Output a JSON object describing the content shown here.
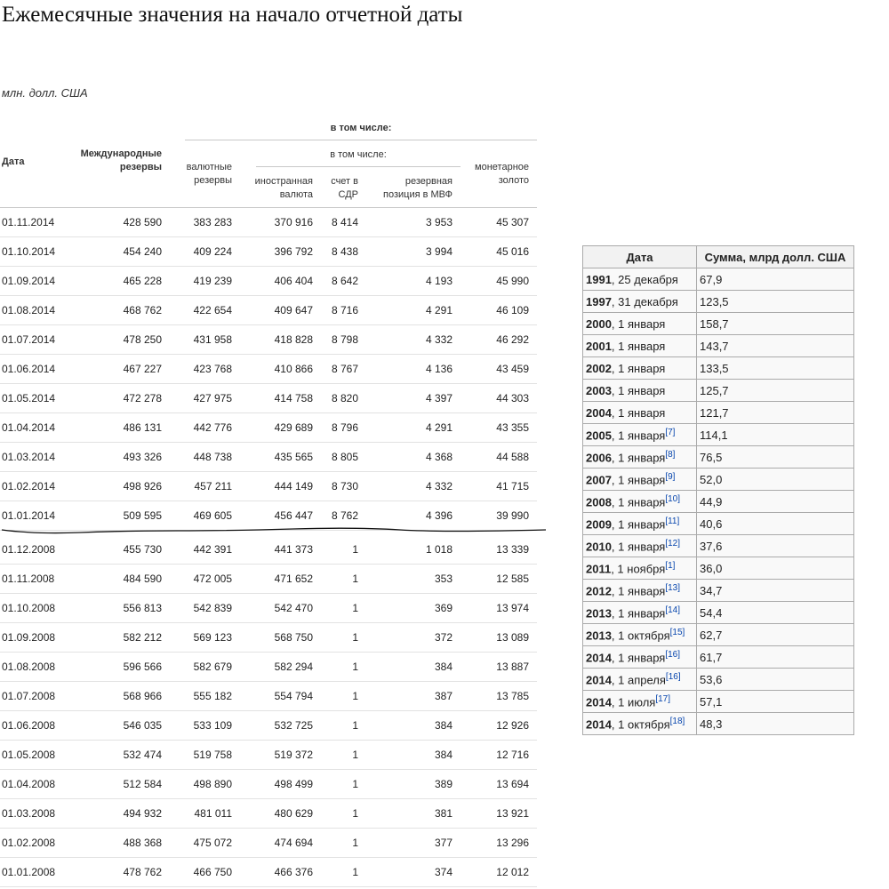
{
  "title": "Ежемесячные значения на начало отчетной даты",
  "units": "млн. долл. США",
  "header": {
    "date": "Дата",
    "intl_reserves": [
      "Международные",
      "резервы"
    ],
    "incl_top": "в том числе:",
    "fx_reserves": [
      "валютные",
      "резервы"
    ],
    "incl_sub": "в том числе:",
    "foreign_currency": [
      "иностранная",
      "валюта"
    ],
    "sdr": [
      "счет в",
      "СДР"
    ],
    "imf_position": [
      "резервная",
      "позиция в МВФ"
    ],
    "gold": [
      "монетарное",
      "золото"
    ]
  },
  "rows_2014": [
    [
      "01.11.2014",
      "428 590",
      "383 283",
      "370 916",
      "8 414",
      "3 953",
      "45 307"
    ],
    [
      "01.10.2014",
      "454 240",
      "409 224",
      "396 792",
      "8 438",
      "3 994",
      "45 016"
    ],
    [
      "01.09.2014",
      "465 228",
      "419 239",
      "406 404",
      "8 642",
      "4 193",
      "45 990"
    ],
    [
      "01.08.2014",
      "468 762",
      "422 654",
      "409 647",
      "8 716",
      "4 291",
      "46 109"
    ],
    [
      "01.07.2014",
      "478 250",
      "431 958",
      "418 828",
      "8 798",
      "4 332",
      "46 292"
    ],
    [
      "01.06.2014",
      "467 227",
      "423 768",
      "410 866",
      "8 767",
      "4 136",
      "43 459"
    ],
    [
      "01.05.2014",
      "472 278",
      "427 975",
      "414 758",
      "8 820",
      "4 397",
      "44 303"
    ],
    [
      "01.04.2014",
      "486 131",
      "442 776",
      "429 689",
      "8 796",
      "4 291",
      "43 355"
    ],
    [
      "01.03.2014",
      "493 326",
      "448 738",
      "435 565",
      "8 805",
      "4 368",
      "44 588"
    ],
    [
      "01.02.2014",
      "498 926",
      "457 211",
      "444 149",
      "8 730",
      "4 332",
      "41 715"
    ],
    [
      "01.01.2014",
      "509 595",
      "469 605",
      "456 447",
      "8 762",
      "4 396",
      "39 990"
    ]
  ],
  "rows_2008": [
    [
      "01.12.2008",
      "455 730",
      "442 391",
      "441 373",
      "1",
      "1 018",
      "13 339"
    ],
    [
      "01.11.2008",
      "484 590",
      "472 005",
      "471 652",
      "1",
      "353",
      "12 585"
    ],
    [
      "01.10.2008",
      "556 813",
      "542 839",
      "542 470",
      "1",
      "369",
      "13 974"
    ],
    [
      "01.09.2008",
      "582 212",
      "569 123",
      "568 750",
      "1",
      "372",
      "13 089"
    ],
    [
      "01.08.2008",
      "596 566",
      "582 679",
      "582 294",
      "1",
      "384",
      "13 887"
    ],
    [
      "01.07.2008",
      "568 966",
      "555 182",
      "554 794",
      "1",
      "387",
      "13 785"
    ],
    [
      "01.06.2008",
      "546 035",
      "533 109",
      "532 725",
      "1",
      "384",
      "12 926"
    ],
    [
      "01.05.2008",
      "532 474",
      "519 758",
      "519 372",
      "1",
      "384",
      "12 716"
    ],
    [
      "01.04.2008",
      "512 584",
      "498 890",
      "498 499",
      "1",
      "389",
      "13 694"
    ],
    [
      "01.03.2008",
      "494 932",
      "481 011",
      "480 629",
      "1",
      "381",
      "13 921"
    ],
    [
      "01.02.2008",
      "488 368",
      "475 072",
      "474 694",
      "1",
      "377",
      "13 296"
    ],
    [
      "01.01.2008",
      "478 762",
      "466 750",
      "466 376",
      "1",
      "374",
      "12 012"
    ]
  ],
  "side_table": {
    "col_date": "Дата",
    "col_sum": "Сумма, млрд долл. США",
    "rows": [
      {
        "year": "1991",
        "rest": ", 25 декабря",
        "ref": "",
        "value": "67,9"
      },
      {
        "year": "1997",
        "rest": ", 31 декабря",
        "ref": "",
        "value": "123,5"
      },
      {
        "year": "2000",
        "rest": ", 1 января",
        "ref": "",
        "value": "158,7"
      },
      {
        "year": "2001",
        "rest": ", 1 января",
        "ref": "",
        "value": "143,7"
      },
      {
        "year": "2002",
        "rest": ", 1 января",
        "ref": "",
        "value": "133,5"
      },
      {
        "year": "2003",
        "rest": ", 1 января",
        "ref": "",
        "value": "125,7"
      },
      {
        "year": "2004",
        "rest": ", 1 января",
        "ref": "",
        "value": "121,7"
      },
      {
        "year": "2005",
        "rest": ", 1 января",
        "ref": "[7]",
        "value": "114,1"
      },
      {
        "year": "2006",
        "rest": ", 1 января",
        "ref": "[8]",
        "value": "76,5"
      },
      {
        "year": "2007",
        "rest": ", 1 января",
        "ref": "[9]",
        "value": "52,0"
      },
      {
        "year": "2008",
        "rest": ", 1 января",
        "ref": "[10]",
        "value": "44,9"
      },
      {
        "year": "2009",
        "rest": ", 1 января",
        "ref": "[11]",
        "value": "40,6"
      },
      {
        "year": "2010",
        "rest": ", 1 января",
        "ref": "[12]",
        "value": "37,6"
      },
      {
        "year": "2011",
        "rest": ", 1 ноября",
        "ref": "[1]",
        "value": "36,0"
      },
      {
        "year": "2012",
        "rest": ", 1 января",
        "ref": "[13]",
        "value": "34,7"
      },
      {
        "year": "2013",
        "rest": ", 1 января",
        "ref": "[14]",
        "value": "54,4"
      },
      {
        "year": "2013",
        "rest": ", 1 октября",
        "ref": "[15]",
        "value": "62,7"
      },
      {
        "year": "2014",
        "rest": ", 1 января",
        "ref": "[16]",
        "value": "61,7"
      },
      {
        "year": "2014",
        "rest": ", 1 апреля",
        "ref": "[16]",
        "value": "53,6"
      },
      {
        "year": "2014",
        "rest": ", 1 июля",
        "ref": "[17]",
        "value": "57,1"
      },
      {
        "year": "2014",
        "rest": ", 1 октября",
        "ref": "[18]",
        "value": "48,3"
      }
    ]
  }
}
